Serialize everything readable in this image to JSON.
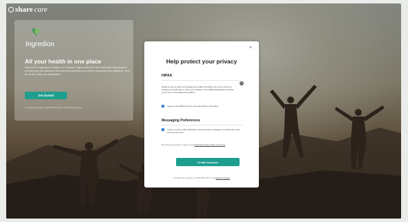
{
  "header": {
    "logo_share": "share",
    "logo_care": "care"
  },
  "promo_card": {
    "brand_name": "Ingredion",
    "title": "All your health in one place",
    "description": "Welcome to Ingredion's Healthy You Program. Signed with our Care First value, this program provides you with access to the tools and resources you need to maximize your wellbeing - let's be all fit to make our lives better!",
    "button_label": "Get Started",
    "support_text": "For Sharecare support, call 855-558-7515 or visit Member Support"
  },
  "modal": {
    "close_glyph": "×",
    "title": "Help protect your privacy",
    "hipaa": {
      "heading": "HIPAA",
      "text": "Would you like to share and manage your health information even if you choose to change your health plan or leave your employer? Your HIPAA authorization will allow you to do so on the Sharecare platform.",
      "checkbox_label": "I agree to the HIPAA Terms to Use and Disclose Information"
    },
    "messaging": {
      "heading": "Messaging Preferences",
      "checkbox_label": "I want to receive email notifications, alerts and other messages from Sharecare (I can opt out at any time)."
    },
    "consent": {
      "prefix": "By creating an account, I agree to the ",
      "link": "Sharecare Privacy Policy and Terms",
      "suffix": "."
    },
    "create_button": "Create Account",
    "support": {
      "prefix": "For Sharecare support, call 855-558-7515 or visit ",
      "link": "Member Support"
    }
  },
  "colors": {
    "accent": "#1f9e8e",
    "checkbox": "#2a74c9",
    "overlay": "#141414"
  },
  "icons": {
    "info": "info-icon",
    "checkbox": "checkmark-icon",
    "close": "close-icon",
    "brand": "ingredion-leaf-icon"
  }
}
